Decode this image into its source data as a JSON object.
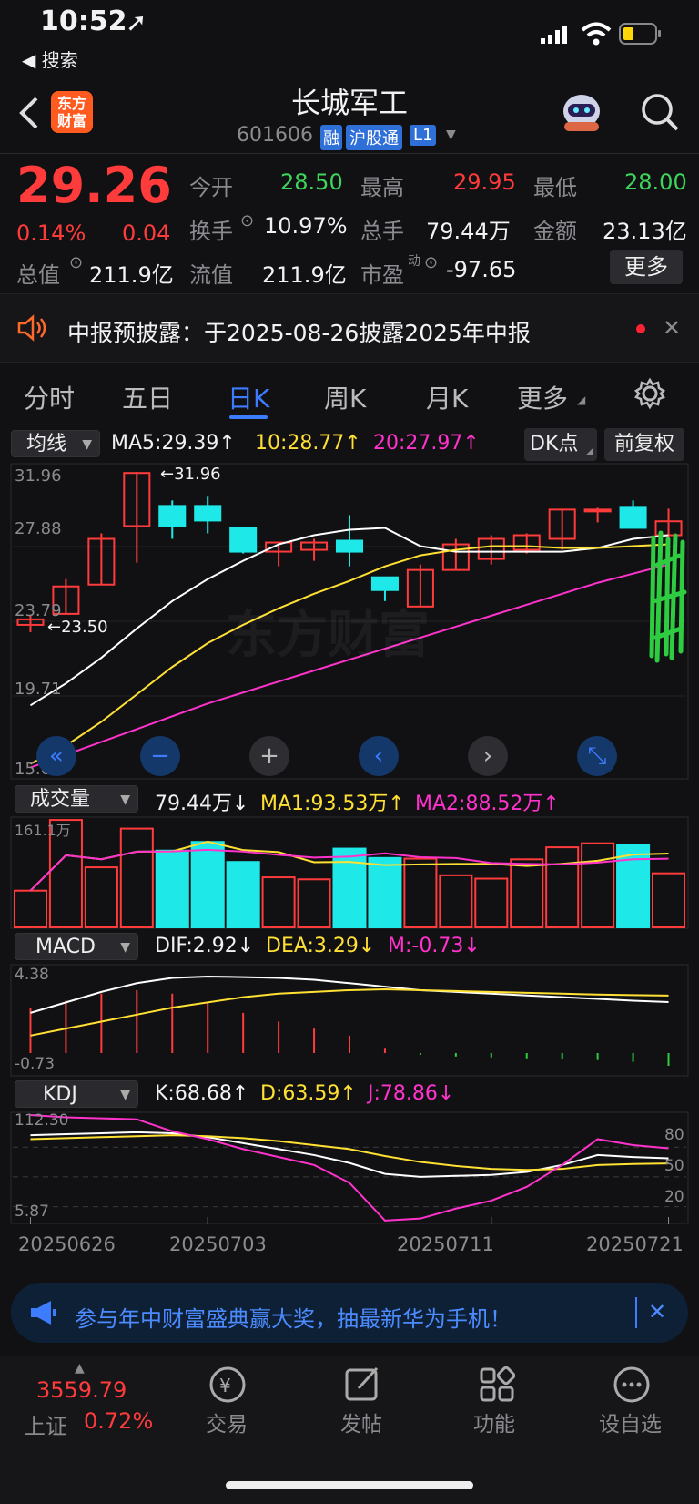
{
  "status": {
    "time": "10:52",
    "back_label": "◀ 搜索"
  },
  "header": {
    "title": "长城军工",
    "code": "601606",
    "badges": [
      "融",
      "沪股通",
      "L1"
    ],
    "logo_text": [
      "东方",
      "财富"
    ]
  },
  "quote": {
    "price": "29.26",
    "pct": "0.14%",
    "chg": "0.04",
    "fields": [
      {
        "label": "今开",
        "value": "28.50",
        "color": "green"
      },
      {
        "label": "最高",
        "value": "29.95",
        "color": "red"
      },
      {
        "label": "最低",
        "value": "28.00",
        "color": "green"
      },
      {
        "label": "换手",
        "value": "10.97%",
        "color": "white"
      },
      {
        "label": "总手",
        "value": "79.44万",
        "color": "white"
      },
      {
        "label": "金额",
        "value": "23.13亿",
        "color": "white"
      },
      {
        "label": "总值",
        "value": "211.9亿",
        "color": "white"
      },
      {
        "label": "流值",
        "value": "211.9亿",
        "color": "white"
      },
      {
        "label": "市盈",
        "value": "-97.65",
        "color": "white"
      }
    ],
    "pe_sup": "动",
    "more": "更多"
  },
  "notice": {
    "text": "中报预披露：于2025-08-26披露2025年中报"
  },
  "tabs": [
    "分时",
    "五日",
    "日K",
    "周K",
    "月K",
    "更多"
  ],
  "active_tab": "日K",
  "kline": {
    "indicator": "均线",
    "ma5": "MA5:29.39↑",
    "ma10": "10:28.77↑",
    "ma20": "20:27.97↑",
    "dk": "DK点",
    "adjust": "前复权",
    "y_labels": [
      "31.96",
      "27.88",
      "23.79",
      "19.71",
      "15.63"
    ],
    "high_label": "←31.96",
    "low_label": "←23.50",
    "watermark": "东方财富"
  },
  "volume": {
    "indicator": "成交量",
    "vol": "79.44万↓",
    "ma1": "MA1:93.53万↑",
    "ma2": "MA2:88.52万↑",
    "top": "161.1万"
  },
  "macd": {
    "indicator": "MACD",
    "dif": "DIF:2.92↓",
    "dea": "DEA:3.29↓",
    "m": "M:-0.73↓",
    "top": "4.38",
    "bottom": "-0.73"
  },
  "kdj": {
    "indicator": "KDJ",
    "k": "K:68.68↑",
    "d": "D:63.59↑",
    "j": "J:78.86↓",
    "top": "112.30",
    "bottom": "5.87",
    "levels": [
      "80",
      "50",
      "20"
    ]
  },
  "dates": [
    "20250626",
    "20250703",
    "20250711",
    "20250721"
  ],
  "ad": {
    "text": "参与年中财富盛典赢大奖，抽最新华为手机！"
  },
  "bottom_nav": {
    "index_value": "3559.79",
    "index_name": "上证",
    "index_pct": "0.72%",
    "items": [
      "交易",
      "发帖",
      "功能",
      "设自选"
    ]
  },
  "colors": {
    "up": "#ff3b3b",
    "down": "#1ee8e8",
    "ma5": "#ffffff",
    "ma10": "#ffe033",
    "ma20": "#ff33cc",
    "accent": "#3d7bff"
  },
  "chart_data": {
    "type": "candlestick",
    "candles": [
      {
        "o": 23.6,
        "h": 24.1,
        "l": 23.2,
        "c": 23.9
      },
      {
        "o": 24.2,
        "h": 26.1,
        "l": 24.2,
        "c": 25.7
      },
      {
        "o": 25.8,
        "h": 28.6,
        "l": 25.8,
        "c": 28.3
      },
      {
        "o": 29.0,
        "h": 31.96,
        "l": 27.0,
        "c": 31.9
      },
      {
        "o": 30.1,
        "h": 30.4,
        "l": 28.3,
        "c": 29.0
      },
      {
        "o": 30.1,
        "h": 30.6,
        "l": 28.6,
        "c": 29.3
      },
      {
        "o": 28.9,
        "h": 28.9,
        "l": 27.5,
        "c": 27.6
      },
      {
        "o": 27.6,
        "h": 28.1,
        "l": 26.8,
        "c": 28.1
      },
      {
        "o": 27.7,
        "h": 28.3,
        "l": 27.1,
        "c": 28.1
      },
      {
        "o": 28.2,
        "h": 29.6,
        "l": 26.8,
        "c": 27.6
      },
      {
        "o": 26.2,
        "h": 26.2,
        "l": 24.9,
        "c": 25.5
      },
      {
        "o": 24.6,
        "h": 26.9,
        "l": 24.6,
        "c": 26.6
      },
      {
        "o": 26.6,
        "h": 28.3,
        "l": 26.6,
        "c": 28.0
      },
      {
        "o": 27.2,
        "h": 28.5,
        "l": 26.9,
        "c": 28.3
      },
      {
        "o": 27.7,
        "h": 28.6,
        "l": 27.5,
        "c": 28.5
      },
      {
        "o": 28.3,
        "h": 29.9,
        "l": 27.7,
        "c": 29.9
      },
      {
        "o": 29.9,
        "h": 30.0,
        "l": 29.2,
        "c": 29.9
      },
      {
        "o": 30.0,
        "h": 30.4,
        "l": 28.9,
        "c": 28.9
      },
      {
        "o": 28.5,
        "h": 29.95,
        "l": 28.0,
        "c": 29.26
      }
    ],
    "ma5": [
      19.2,
      20.4,
      21.8,
      23.4,
      24.9,
      26.1,
      27.1,
      28.0,
      28.5,
      28.8,
      28.9,
      27.9,
      27.6,
      27.6,
      27.6,
      27.6,
      27.8,
      28.3,
      28.5
    ],
    "ma10": [
      16.0,
      17.0,
      18.3,
      19.8,
      21.3,
      22.6,
      23.6,
      24.5,
      25.3,
      26.0,
      26.8,
      27.4,
      27.7,
      27.9,
      27.9,
      27.8,
      27.8,
      27.9,
      28.0
    ],
    "ma20": [
      15.8,
      16.5,
      17.2,
      17.9,
      18.6,
      19.3,
      19.9,
      20.5,
      21.1,
      21.7,
      22.3,
      22.9,
      23.5,
      24.1,
      24.7,
      25.3,
      25.9,
      26.4,
      26.9
    ],
    "ylim": [
      15.63,
      31.96
    ],
    "volume": [
      55,
      161,
      90,
      148,
      115,
      128,
      98,
      75,
      72,
      118,
      104,
      103,
      78,
      73,
      102,
      120,
      126,
      124,
      81
    ],
    "vol_ylim": [
      0,
      161.1
    ],
    "macd_dif": [
      2.3,
      2.9,
      3.5,
      4.0,
      4.3,
      4.38,
      4.35,
      4.3,
      4.2,
      4.0,
      3.8,
      3.6,
      3.5,
      3.4,
      3.3,
      3.2,
      3.1,
      3.0,
      2.92
    ],
    "macd_dea": [
      1.0,
      1.4,
      1.8,
      2.2,
      2.6,
      2.9,
      3.2,
      3.4,
      3.5,
      3.6,
      3.65,
      3.6,
      3.55,
      3.5,
      3.45,
      3.4,
      3.35,
      3.32,
      3.29
    ],
    "macd_m": [
      2.6,
      3.0,
      3.4,
      3.6,
      3.4,
      2.9,
      2.3,
      1.8,
      1.4,
      1.0,
      0.3,
      -0.1,
      -0.2,
      -0.25,
      -0.3,
      -0.35,
      -0.4,
      -0.5,
      -0.73
    ],
    "macd_ylim": [
      -0.73,
      4.38
    ],
    "k": [
      92,
      93,
      94,
      95,
      94,
      90,
      84,
      78,
      72,
      64,
      53,
      50,
      51,
      52,
      55,
      62,
      72,
      70,
      68.68
    ],
    "d": [
      88,
      89,
      90,
      91,
      92,
      91,
      89,
      86,
      82,
      78,
      71,
      65,
      61,
      58,
      57,
      58,
      62,
      63,
      63.59
    ],
    "j": [
      112.3,
      110,
      109,
      108,
      96,
      88,
      78,
      70,
      62,
      44,
      6,
      8,
      18,
      26,
      40,
      62,
      88,
      82,
      78.86
    ],
    "kdj_ylim": [
      5.87,
      112.3
    ]
  }
}
